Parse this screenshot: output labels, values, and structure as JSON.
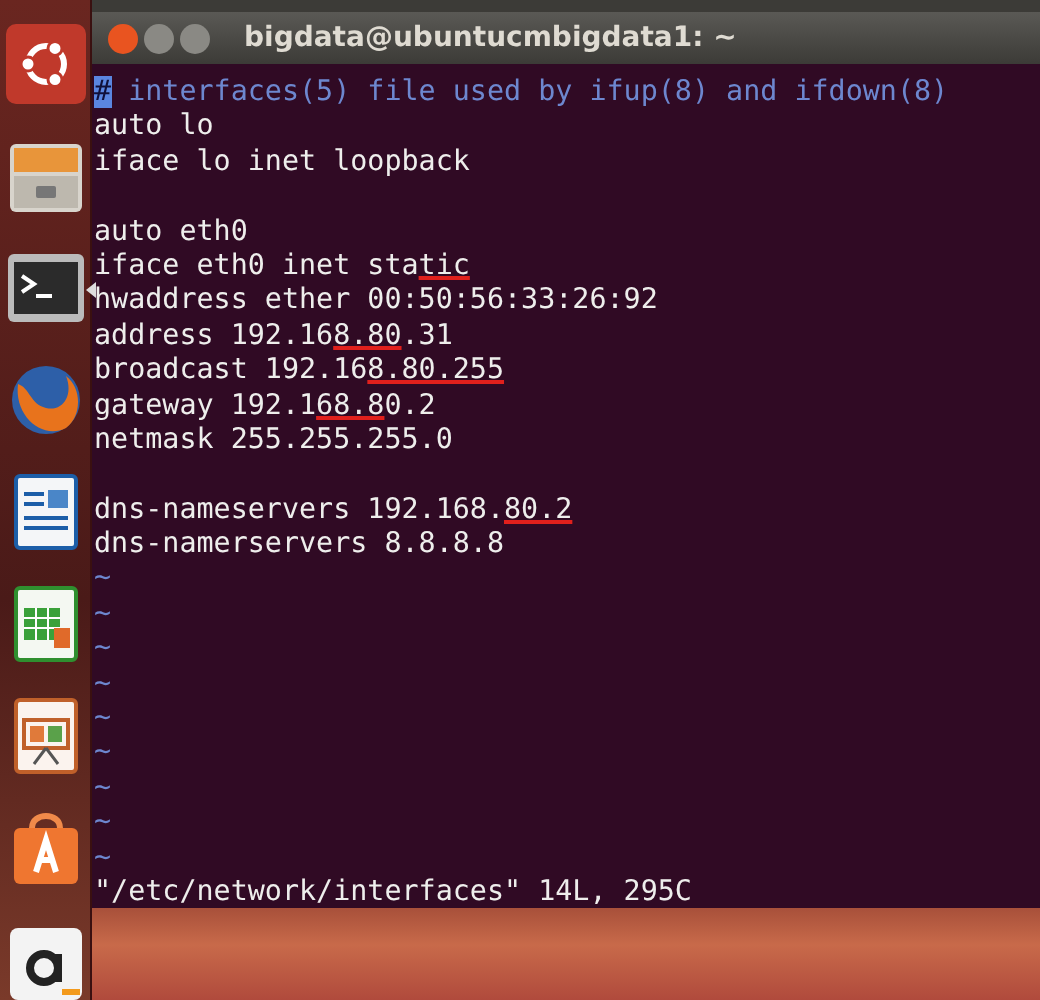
{
  "launcher": {
    "items": [
      {
        "kind": "ubuntu",
        "running": false
      },
      {
        "kind": "files",
        "running": false
      },
      {
        "kind": "terminal",
        "running": true
      },
      {
        "kind": "browser",
        "running": false
      },
      {
        "kind": "writer",
        "running": false
      },
      {
        "kind": "calc",
        "running": false
      },
      {
        "kind": "impress",
        "running": false
      },
      {
        "kind": "software",
        "running": false
      },
      {
        "kind": "amazon",
        "running": false
      }
    ]
  },
  "window": {
    "title": "bigdata@ubuntucmbigdata1: ~"
  },
  "editor": {
    "lines": [
      {
        "kind": "comment",
        "segments": [
          {
            "text": "#",
            "cursor": true,
            "underlined": false
          },
          {
            "text": " interfaces(5) file used by ifup(8) and ifdown(8)",
            "cursor": false,
            "underlined": false
          }
        ]
      },
      {
        "kind": "text",
        "segments": [
          {
            "text": "auto lo",
            "cursor": false,
            "underlined": false
          }
        ]
      },
      {
        "kind": "text",
        "segments": [
          {
            "text": "iface lo inet loopback",
            "cursor": false,
            "underlined": false
          }
        ]
      },
      {
        "kind": "blank"
      },
      {
        "kind": "text",
        "segments": [
          {
            "text": "auto eth0",
            "cursor": false,
            "underlined": false
          }
        ]
      },
      {
        "kind": "text",
        "segments": [
          {
            "text": "iface eth0 inet sta",
            "cursor": false,
            "underlined": false
          },
          {
            "text": "tic",
            "cursor": false,
            "underlined": true
          }
        ]
      },
      {
        "kind": "text",
        "segments": [
          {
            "text": "hwaddress ether 00:50:56:33:26:92",
            "cursor": false,
            "underlined": false
          }
        ]
      },
      {
        "kind": "text",
        "segments": [
          {
            "text": "address 192.16",
            "cursor": false,
            "underlined": false
          },
          {
            "text": "8.80",
            "cursor": false,
            "underlined": true
          },
          {
            "text": ".31",
            "cursor": false,
            "underlined": false
          }
        ]
      },
      {
        "kind": "text",
        "segments": [
          {
            "text": "broadcast 192.16",
            "cursor": false,
            "underlined": false
          },
          {
            "text": "8.80.255",
            "cursor": false,
            "underlined": true
          }
        ]
      },
      {
        "kind": "text",
        "segments": [
          {
            "text": "gateway 192.1",
            "cursor": false,
            "underlined": false
          },
          {
            "text": "68.8",
            "cursor": false,
            "underlined": true
          },
          {
            "text": "0.2",
            "cursor": false,
            "underlined": false
          }
        ]
      },
      {
        "kind": "text",
        "segments": [
          {
            "text": "netmask 255.255.255.0",
            "cursor": false,
            "underlined": false
          }
        ]
      },
      {
        "kind": "blank"
      },
      {
        "kind": "text",
        "segments": [
          {
            "text": "dns-nameservers 192.168.",
            "cursor": false,
            "underlined": false
          },
          {
            "text": "80.2",
            "cursor": false,
            "underlined": true
          }
        ]
      },
      {
        "kind": "text",
        "segments": [
          {
            "text": "dns-namerservers 8.8.8.8",
            "cursor": false,
            "underlined": false
          }
        ]
      },
      {
        "kind": "tilde",
        "segments": [
          {
            "text": "~",
            "cursor": false,
            "underlined": false
          }
        ]
      },
      {
        "kind": "tilde",
        "segments": [
          {
            "text": "~",
            "cursor": false,
            "underlined": false
          }
        ]
      },
      {
        "kind": "tilde",
        "segments": [
          {
            "text": "~",
            "cursor": false,
            "underlined": false
          }
        ]
      },
      {
        "kind": "tilde",
        "segments": [
          {
            "text": "~",
            "cursor": false,
            "underlined": false
          }
        ]
      },
      {
        "kind": "tilde",
        "segments": [
          {
            "text": "~",
            "cursor": false,
            "underlined": false
          }
        ]
      },
      {
        "kind": "tilde",
        "segments": [
          {
            "text": "~",
            "cursor": false,
            "underlined": false
          }
        ]
      },
      {
        "kind": "tilde",
        "segments": [
          {
            "text": "~",
            "cursor": false,
            "underlined": false
          }
        ]
      },
      {
        "kind": "tilde",
        "segments": [
          {
            "text": "~",
            "cursor": false,
            "underlined": false
          }
        ]
      },
      {
        "kind": "tilde",
        "segments": [
          {
            "text": "~",
            "cursor": false,
            "underlined": false
          }
        ]
      }
    ],
    "status": "\"/etc/network/interfaces\" 14L, 295C"
  }
}
